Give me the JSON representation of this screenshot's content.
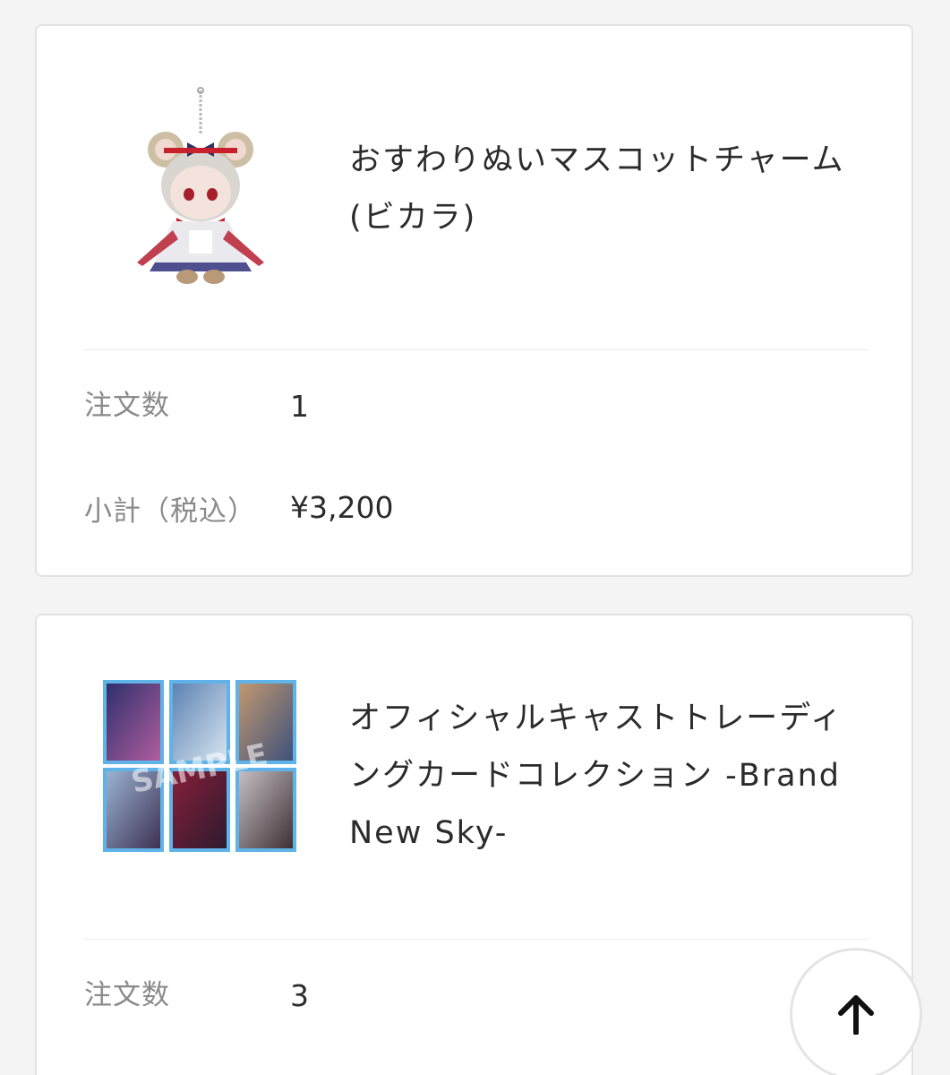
{
  "items": [
    {
      "title": "おすわりぬいマスコットチャーム (ビカラ)",
      "image_icon": "mascot-charm-plush-image",
      "quantity_label": "注文数",
      "quantity": "1",
      "subtotal_label": "小計（税込）",
      "subtotal": "¥3,200"
    },
    {
      "title": "オフィシャルキャストトレーディングカードコレクション -Brand New Sky-",
      "image_icon": "trading-card-collection-image",
      "quantity_label": "注文数",
      "quantity": "3"
    }
  ],
  "scroll_top": {
    "icon": "arrow-up-icon"
  },
  "colors": {
    "background": "#f4f4f4",
    "card": "#ffffff",
    "border": "#e2e2e2",
    "label": "#8a8a8a",
    "text": "#2b2b2b"
  }
}
